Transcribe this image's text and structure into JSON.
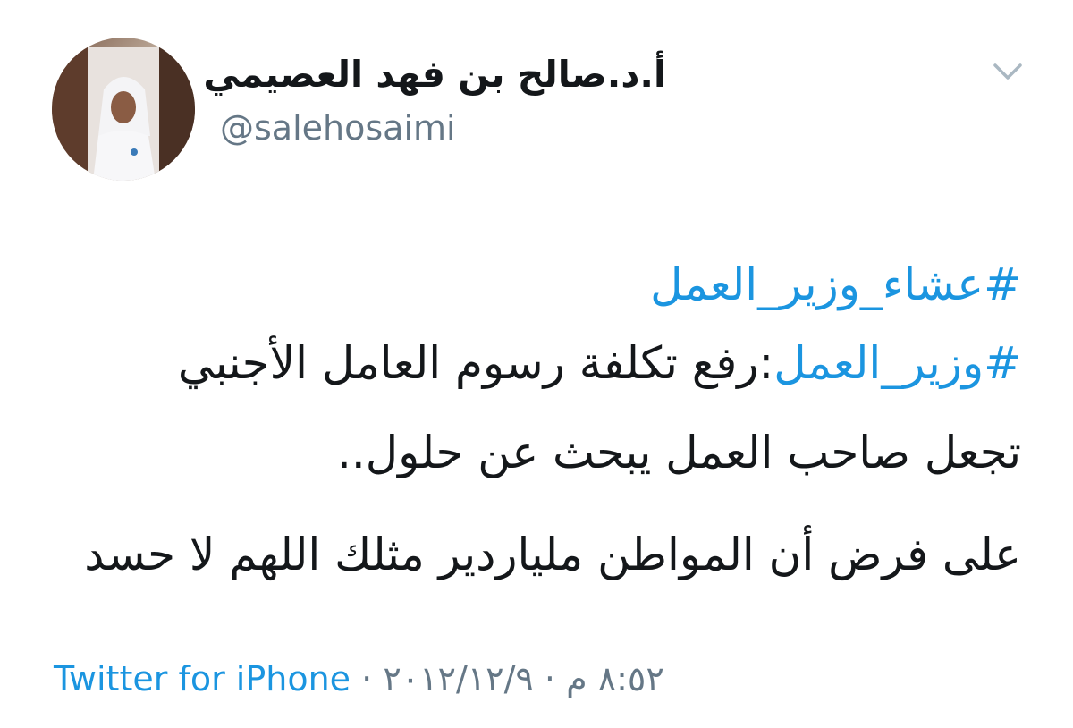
{
  "tweet": {
    "author": {
      "display_name": "أ.د.صالح بن فهد العصيمي",
      "handle": "@salehosaimi"
    },
    "lines": [
      {
        "hashtag": "#عشاء_وزير_العمل",
        "text": ""
      },
      {
        "hashtag": "#وزير_العمل",
        "text": ":رفع تكلفة رسوم العامل الأجنبي"
      },
      {
        "text": "تجعل صاحب العمل يبحث عن حلول.."
      },
      {
        "text": "على فرض أن المواطن ملياردير مثلك اللهم لا حسد"
      }
    ],
    "footer": {
      "source": "Twitter for iPhone",
      "separator": "·",
      "date": "٢٠١٢/١٢/٩",
      "time": "٨:٥٢ م"
    }
  },
  "colors": {
    "accent": "#1b95e0",
    "text": "#14171a",
    "muted": "#657786"
  },
  "icons": {
    "caret": "chevron-down-icon",
    "avatar": "avatar"
  }
}
